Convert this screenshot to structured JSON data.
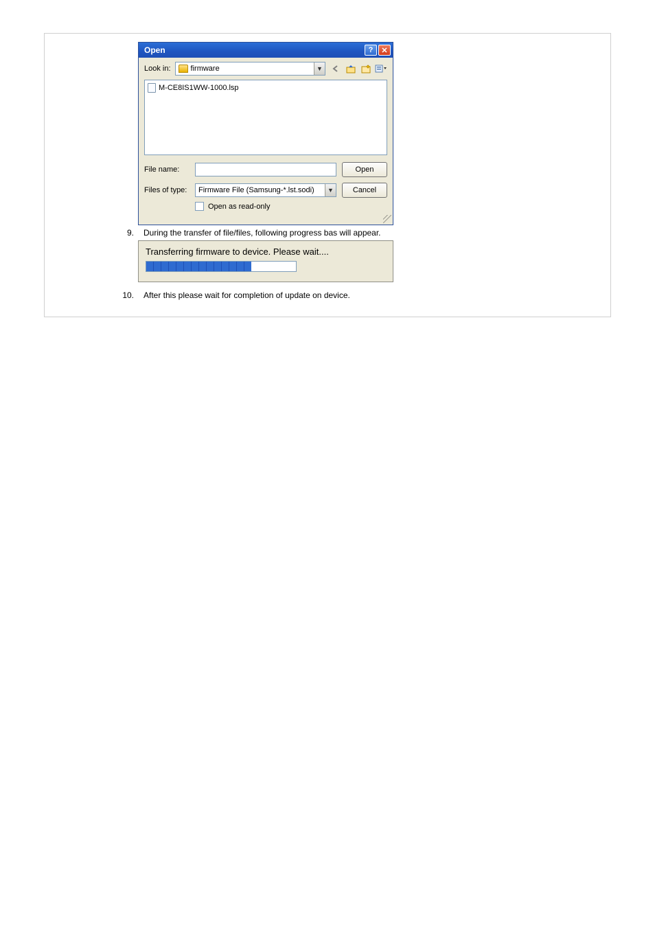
{
  "dialog": {
    "title": "Open",
    "look_in_label": "Look in:",
    "look_in_value": "firmware",
    "file_item": "M-CE8IS1WW-1000.lsp",
    "file_name_label": "File name:",
    "file_name_value": "",
    "files_of_type_label": "Files of type:",
    "files_of_type_value": "Firmware File (Samsung-*.lst.sodi)",
    "open_button": "Open",
    "cancel_button": "Cancel",
    "readonly_label": "Open as read-only"
  },
  "steps": {
    "n9": "9.",
    "t9": "During the transfer of file/files, following progress bas will appear.",
    "n10": "10.",
    "t10": "After this please wait for completion of update on device."
  },
  "progress": {
    "text": "Transferring firmware to device. Please wait....",
    "percent": 70
  }
}
